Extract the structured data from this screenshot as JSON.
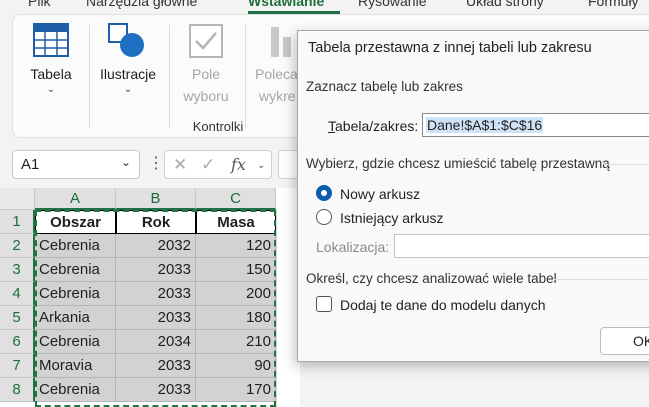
{
  "ribbon_tabs": [
    "Plik",
    "Narzędzia główne",
    "Wstawianie",
    "Rysowanie",
    "Układ strony",
    "Formuły"
  ],
  "ribbon": {
    "tabela": "Tabela",
    "ilustracje": "Ilustracje",
    "pole_l1": "Pole",
    "pole_l2": "wyboru",
    "polecane_l1": "Poleca",
    "polecane_l2": "wykre",
    "group_kontrolki": "Kontrolki"
  },
  "formula_bar": {
    "name_box": "A1",
    "fx": "fx"
  },
  "grid": {
    "columns": [
      "A",
      "B",
      "C"
    ],
    "rows": [
      "1",
      "2",
      "3",
      "4",
      "5",
      "6",
      "7",
      "8"
    ],
    "header": [
      "Obszar",
      "Rok",
      "Masa"
    ],
    "data": [
      [
        "Cebrenia",
        "2032",
        "120"
      ],
      [
        "Cebrenia",
        "2033",
        "150"
      ],
      [
        "Cebrenia",
        "2033",
        "200"
      ],
      [
        "Arkania",
        "2033",
        "180"
      ],
      [
        "Cebrenia",
        "2034",
        "210"
      ],
      [
        "Moravia",
        "2033",
        "90"
      ],
      [
        "Cebrenia",
        "2033",
        "170"
      ]
    ]
  },
  "dialog": {
    "title": "Tabela przestawna z innej tabeli lub zakresu",
    "section_select": "Zaznacz tabelę lub zakres",
    "range_label": "Tabela/zakres:",
    "range_value": "Dane!$A$1:$C$16",
    "section_location": "Wybierz, gdzie chcesz umieścić tabelę przestawną",
    "radio_new": "Nowy arkusz",
    "radio_existing": "Istniejący arkusz",
    "location_label": "Lokalizacja:",
    "location_value": "",
    "section_multi": "Określ, czy chcesz analizować wiele tabel",
    "checkbox_model": "Dodaj te dane do modelu danych",
    "ok_label": "OK"
  },
  "colors": {
    "excel_green": "#217346",
    "radio_blue": "#0b5cad"
  }
}
